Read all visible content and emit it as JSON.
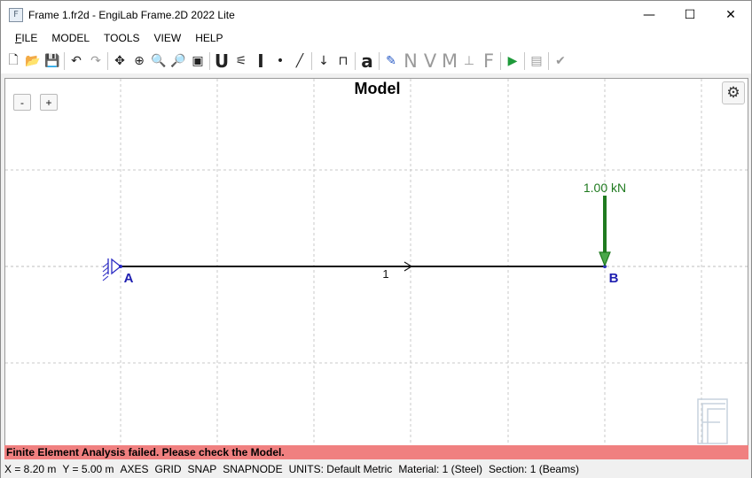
{
  "window": {
    "title": "Frame 1.fr2d - EngiLab Frame.2D 2022 Lite",
    "app_icon": "frame2d-app-icon",
    "controls": {
      "minimize": "—",
      "maximize": "☐",
      "close": "✕"
    }
  },
  "menu": [
    {
      "label": "FILE",
      "underline": "F",
      "rest": "ILE"
    },
    {
      "label": "MODEL"
    },
    {
      "label": "TOOLS"
    },
    {
      "label": "VIEW"
    },
    {
      "label": "HELP"
    }
  ],
  "toolbar": {
    "groups": [
      [
        {
          "name": "new-file-icon",
          "glyph": "🗋",
          "enabled": true
        },
        {
          "name": "open-file-icon",
          "glyph": "📂",
          "enabled": true
        },
        {
          "name": "save-icon",
          "glyph": "💾",
          "enabled": true
        }
      ],
      [
        {
          "name": "undo-icon",
          "glyph": "↶",
          "enabled": true
        },
        {
          "name": "redo-icon",
          "glyph": "↷",
          "enabled": false
        }
      ],
      [
        {
          "name": "pan-icon",
          "glyph": "✥",
          "enabled": true
        },
        {
          "name": "zoom-in-icon",
          "glyph": "⊕",
          "enabled": true
        },
        {
          "name": "zoom-window-icon",
          "glyph": "🔍",
          "enabled": true
        },
        {
          "name": "zoom-extents-icon",
          "glyph": "🔎",
          "enabled": true
        },
        {
          "name": "redraw-icon",
          "glyph": "▣",
          "enabled": true
        }
      ],
      [
        {
          "name": "units-icon",
          "glyph": "U",
          "enabled": true,
          "big": true
        },
        {
          "name": "material-icon",
          "glyph": "⚟",
          "enabled": true
        },
        {
          "name": "section-icon",
          "glyph": "I",
          "enabled": true,
          "big": true
        },
        {
          "name": "node-icon",
          "glyph": "•",
          "enabled": true
        },
        {
          "name": "element-icon",
          "glyph": "╱",
          "enabled": true
        }
      ],
      [
        {
          "name": "nodal-load-icon",
          "glyph": "↓",
          "enabled": true
        },
        {
          "name": "support-icon",
          "glyph": "⊓",
          "enabled": true
        }
      ],
      [
        {
          "name": "text-icon",
          "glyph": "a",
          "enabled": true,
          "big": true
        }
      ],
      [
        {
          "name": "draw-pencil-icon",
          "glyph": "✎",
          "enabled": true,
          "color": "#2357c4"
        },
        {
          "name": "axial-force-icon",
          "glyph": "N",
          "enabled": false,
          "letter": true
        },
        {
          "name": "shear-force-icon",
          "glyph": "V",
          "enabled": false,
          "letter": true
        },
        {
          "name": "bending-moment-icon",
          "glyph": "M",
          "enabled": false,
          "letter": true
        },
        {
          "name": "reactions-icon",
          "glyph": "⊥",
          "enabled": false
        },
        {
          "name": "forces-icon",
          "glyph": "F",
          "enabled": false,
          "letter": true
        }
      ],
      [
        {
          "name": "run-analysis-icon",
          "glyph": "▶",
          "enabled": true,
          "color": "#1e9a3a"
        }
      ],
      [
        {
          "name": "report-icon",
          "glyph": "▤",
          "enabled": false
        }
      ],
      [
        {
          "name": "check-model-icon",
          "glyph": "✔",
          "enabled": false
        }
      ]
    ]
  },
  "canvas": {
    "title": "Model",
    "zoom_out_label": "-",
    "zoom_in_label": "+",
    "settings_icon": "gear-icon",
    "settings_glyph": "⚙",
    "nodes": [
      {
        "label": "A"
      },
      {
        "label": "B"
      }
    ],
    "element_label": "1",
    "load": {
      "label": "1.00 kN",
      "color": "#1f7a1f"
    },
    "node_label_color": "#1f1fb0",
    "watermark": "F2"
  },
  "error_message": "Finite Element Analysis failed. Please check the Model.",
  "status": {
    "x": "X = 8.20 m",
    "y": "Y = 5.00 m",
    "axes": "AXES",
    "grid": "GRID",
    "snap": "SNAP",
    "snapnode": "SNAPNODE",
    "units_label": "UNITS:",
    "units_value": "Default Metric",
    "material": "Material: 1 (Steel)",
    "section": "Section: 1 (Beams)"
  }
}
